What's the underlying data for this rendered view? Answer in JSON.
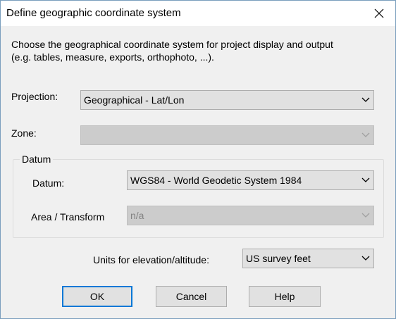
{
  "window": {
    "title": "Define geographic coordinate system"
  },
  "description": {
    "line1": "Choose the geographical coordinate system for project display and output",
    "line2": "(e.g. tables, measure, exports, orthophoto, ...)."
  },
  "projection": {
    "label": "Projection:",
    "value": "Geographical - Lat/Lon"
  },
  "zone": {
    "label": "Zone:",
    "value": ""
  },
  "datum_group": {
    "legend": "Datum",
    "datum": {
      "label": "Datum:",
      "value": "WGS84 - World Geodetic System 1984"
    },
    "area_transform": {
      "label": "Area / Transform",
      "value": "n/a"
    }
  },
  "units": {
    "label": "Units for elevation/altitude:",
    "value": "US survey feet"
  },
  "buttons": {
    "ok": "OK",
    "cancel": "Cancel",
    "help": "Help"
  },
  "colors": {
    "dialog_bg": "#f0f0f0",
    "accent": "#0078d7"
  }
}
